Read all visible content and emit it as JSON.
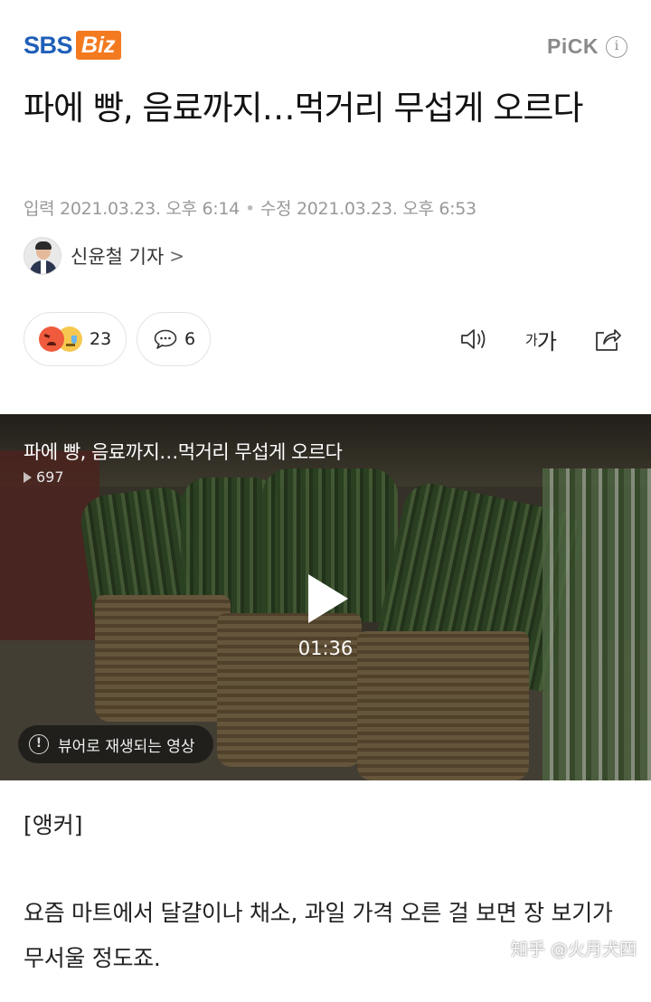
{
  "brand": {
    "sbs": "SBS",
    "biz": "Biz",
    "pick_label": "PiCK",
    "pick_info": "i"
  },
  "headline": "파에 빵, 음료까지…먹거리 무섭게 오르다",
  "dates": {
    "input": "입력 2021.03.23. 오후 6:14",
    "separator": "•",
    "modified": "수정 2021.03.23. 오후 6:53"
  },
  "reporter": {
    "name": "신윤철 기자",
    "chevron": ">"
  },
  "reactions": {
    "count": "23"
  },
  "comments": {
    "count": "6"
  },
  "tools": {
    "font_small": "가",
    "font_large": "가"
  },
  "video": {
    "title": "파에 빵, 음료까지…먹거리 무섭게 오르다",
    "views": "697",
    "duration": "01:36",
    "notice": "뷰어로 재생되는 영상",
    "notice_icon": "!"
  },
  "article": {
    "anchor": "[앵커]",
    "paragraph": "요즘 마트에서 달걀이나 채소, 과일 가격 오른 걸 보면 장 보기가 무서울 정도죠."
  },
  "watermark": "知乎 @火月犬四",
  "colors": {
    "sbs_blue": "#1f5fb8",
    "biz_orange": "#f47a20",
    "angry": "#ef5b3c",
    "sad": "#f7c850"
  }
}
